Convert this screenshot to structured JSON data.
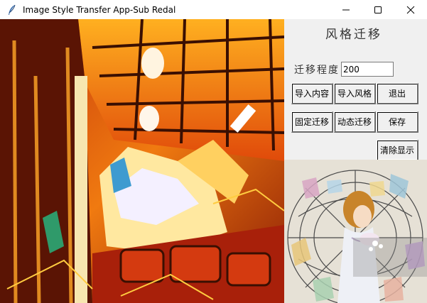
{
  "window": {
    "title": "Image Style Transfer App-Sub Redal"
  },
  "panel": {
    "title": "风格迁移"
  },
  "transfer_degree": {
    "label": "迁移程度",
    "value": "200"
  },
  "buttons": {
    "import_content": "导入内容",
    "import_style": "导入风格",
    "exit": "退出",
    "fixed_transfer": "固定迁移",
    "dynamic_transfer": "动态迁移",
    "save": "保存",
    "clear_display": "清除显示"
  },
  "colors": {
    "titlebar_bg": "#ffffff",
    "window_bg": "#f0f0f0"
  }
}
